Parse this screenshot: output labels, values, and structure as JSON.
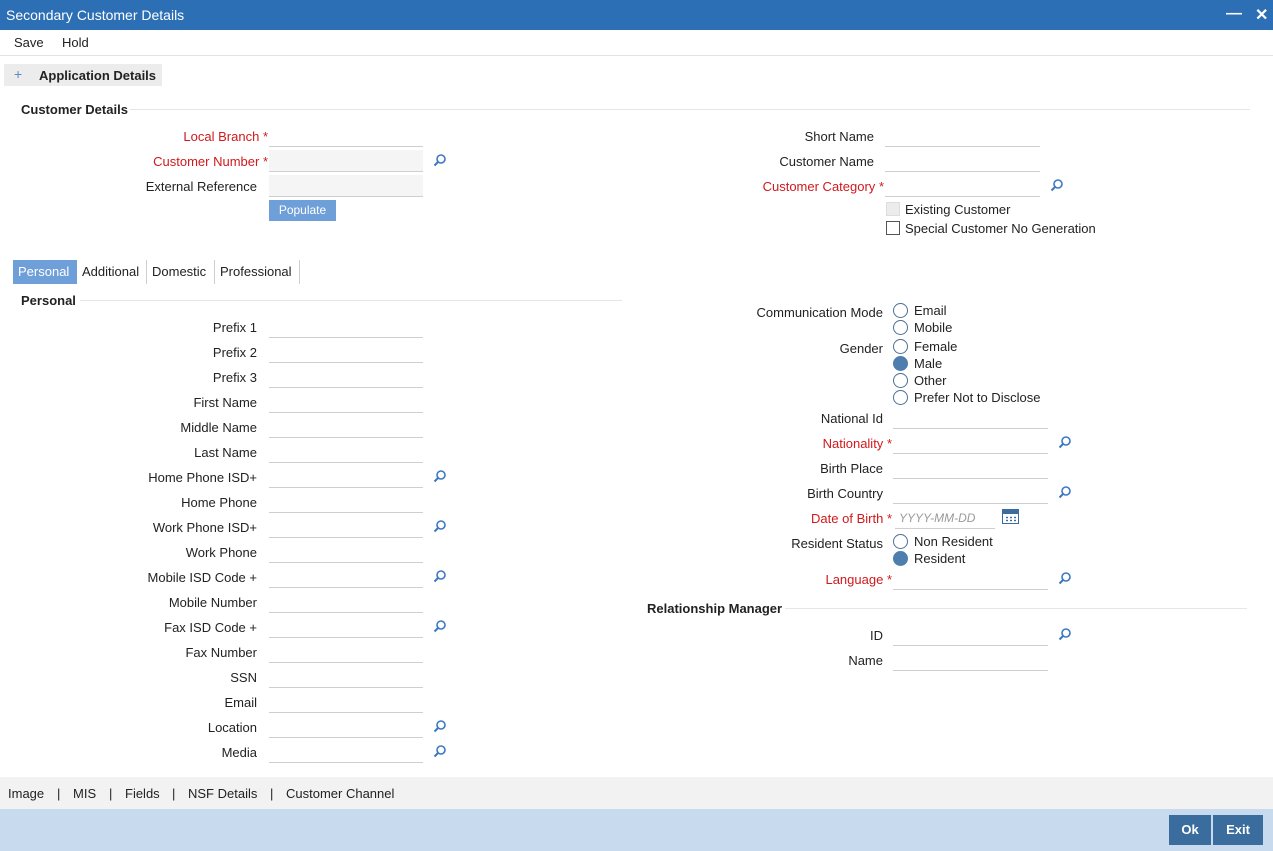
{
  "window": {
    "title": "Secondary Customer Details",
    "minimize_icon": "minimize-icon",
    "close_icon": "close-icon"
  },
  "menu": {
    "save": "Save",
    "hold": "Hold"
  },
  "app_details": {
    "plus": "+",
    "label": "Application Details"
  },
  "customer_details": {
    "title": "Customer Details",
    "local_branch": "Local Branch",
    "customer_number": "Customer Number",
    "external_reference": "External Reference",
    "populate": "Populate",
    "short_name": "Short Name",
    "customer_name": "Customer Name",
    "customer_category": "Customer Category",
    "existing_customer": "Existing Customer",
    "special_customer_no": "Special Customer No Generation",
    "required_mark": "*"
  },
  "tabs": [
    "Personal",
    "Additional",
    "Domestic",
    "Professional"
  ],
  "personal": {
    "title": "Personal",
    "fields": [
      "Prefix 1",
      "Prefix 2",
      "Prefix 3",
      "First Name",
      "Middle Name",
      "Last Name",
      "Home Phone ISD+",
      "Home Phone",
      "Work Phone ISD+",
      "Work Phone",
      "Mobile ISD Code +",
      "Mobile Number",
      "Fax ISD Code +",
      "Fax Number",
      "SSN",
      "Email",
      "Location",
      "Media"
    ]
  },
  "right": {
    "communication_mode": "Communication Mode",
    "comm_options": [
      "Email",
      "Mobile"
    ],
    "gender": "Gender",
    "gender_options": [
      "Female",
      "Male",
      "Other",
      "Prefer Not to Disclose"
    ],
    "gender_selected": "Male",
    "national_id": "National Id",
    "nationality": "Nationality",
    "birth_place": "Birth Place",
    "birth_country": "Birth Country",
    "date_of_birth": "Date of Birth",
    "date_placeholder": "YYYY-MM-DD",
    "resident_status": "Resident Status",
    "resident_options": [
      "Non Resident",
      "Resident"
    ],
    "resident_selected": "Resident",
    "language": "Language",
    "rm_title": "Relationship Manager",
    "rm_id": "ID",
    "rm_name": "Name"
  },
  "footer_links": [
    "Image",
    "|",
    "MIS",
    "|",
    "Fields",
    "|",
    "NSF Details",
    "|",
    "Customer Channel"
  ],
  "buttons": {
    "ok": "Ok",
    "exit": "Exit"
  },
  "colors": {
    "titlebar": "#2c6fb5",
    "accent": "#6f9fd8",
    "required": "#d0191c",
    "button": "#3a6c9e"
  }
}
